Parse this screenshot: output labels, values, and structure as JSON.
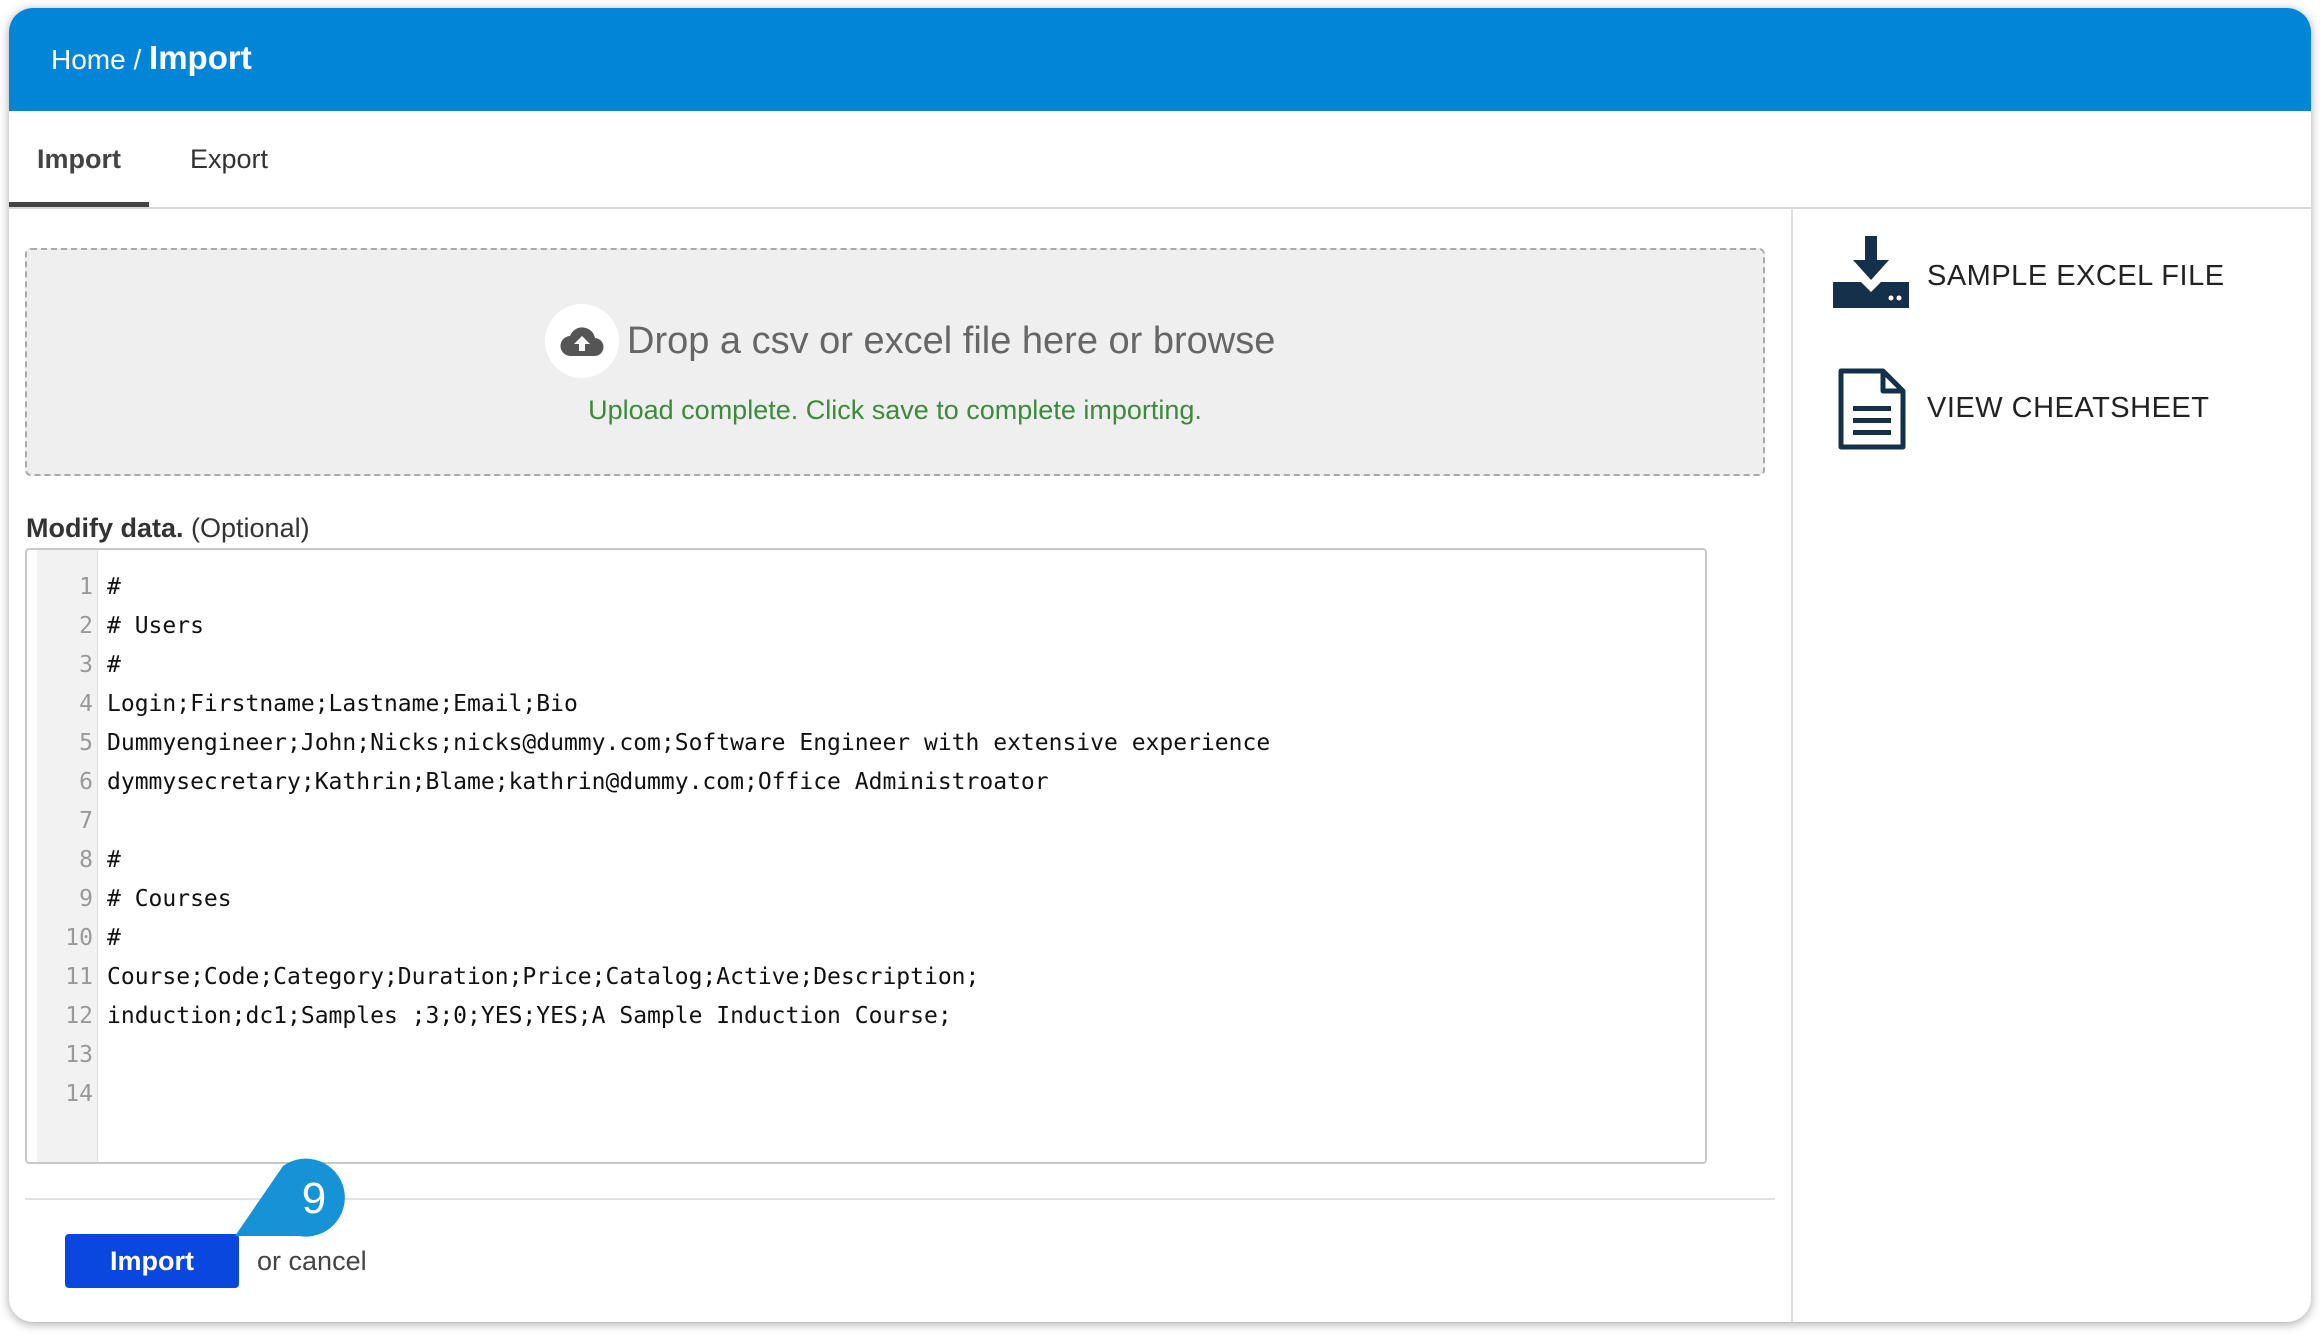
{
  "breadcrumb": {
    "home": "Home",
    "separator": "/",
    "current": "Import"
  },
  "tabs": [
    {
      "label": "Import",
      "active": true
    },
    {
      "label": "Export",
      "active": false
    }
  ],
  "dropzone": {
    "prompt": "Drop a csv or excel file here or browse",
    "status": "Upload complete. Click save to complete importing.",
    "icon": "cloud-upload-icon"
  },
  "modify": {
    "label": "Modify data.",
    "optional": "(Optional)"
  },
  "editor": {
    "lines": [
      {
        "num": "1",
        "text": "#"
      },
      {
        "num": "2",
        "text": "# Users"
      },
      {
        "num": "3",
        "text": "#"
      },
      {
        "num": "4",
        "text": "Login;Firstname;Lastname;Email;Bio"
      },
      {
        "num": "5",
        "text": "Dummyengineer;John;Nicks;nicks@dummy.com;Software Engineer with extensive experience"
      },
      {
        "num": "6",
        "text": "dymmysecretary;Kathrin;Blame;kathrin@dummy.com;Office Administroator"
      },
      {
        "num": "7",
        "text": ""
      },
      {
        "num": "8",
        "text": "#"
      },
      {
        "num": "9",
        "text": "# Courses"
      },
      {
        "num": "10",
        "text": "#"
      },
      {
        "num": "11",
        "text": "Course;Code;Category;Duration;Price;Catalog;Active;Description;"
      },
      {
        "num": "12",
        "text": "induction;dc1;Samples ;3;0;YES;YES;A Sample Induction Course;"
      },
      {
        "num": "13",
        "text": ""
      },
      {
        "num": "14",
        "text": ""
      }
    ]
  },
  "actions": {
    "import_label": "Import",
    "or": "or",
    "cancel_label": "cancel"
  },
  "step_badge": "9",
  "sidebar": {
    "sample_excel": {
      "label": "SAMPLE EXCEL FILE",
      "icon": "download-icon"
    },
    "cheatsheet": {
      "label": "VIEW CHEATSHEET",
      "icon": "document-icon"
    }
  },
  "colors": {
    "header_blue": "#0285d7",
    "button_blue": "#0a47df",
    "success_green": "#3d8a3d",
    "icon_navy": "#15304a"
  }
}
